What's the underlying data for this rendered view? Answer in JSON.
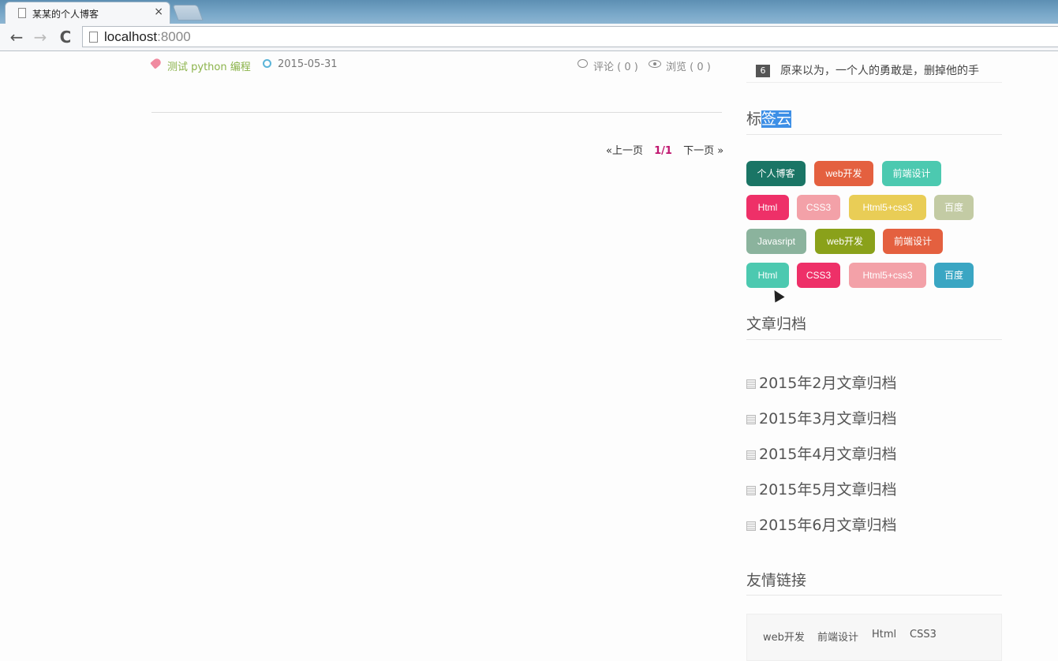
{
  "browser": {
    "tab_title": "某某的个人博客",
    "tab_close": "×",
    "url_host": "localhost",
    "url_port": ":8000",
    "back": "←",
    "forward": "→",
    "reload": "C"
  },
  "post_meta": {
    "tags": "测试 python 编程",
    "date": "2015-05-31",
    "comments": "评论 ( 0 )",
    "views": "浏览 ( 0 )"
  },
  "pager": {
    "prev": "«上一页",
    "current": "1/1",
    "next": "下一页 »"
  },
  "sidebar": {
    "top_item": {
      "rank": "6",
      "title": "原来以为，一个人的勇敢是，删掉他的手"
    },
    "tag_cloud": {
      "title_plain": "标",
      "title_selected": "签云",
      "tags": [
        {
          "label": "个人博客",
          "color": "#1a7565"
        },
        {
          "label": "web开发",
          "color": "#e4603f"
        },
        {
          "label": "前端设计",
          "color": "#4cc9b0"
        },
        {
          "label": "Html",
          "color": "#ee3068"
        },
        {
          "label": "CSS3",
          "color": "#f3a1a8"
        },
        {
          "label": "Html5+css3",
          "color": "#e9cd56"
        },
        {
          "label": "百度",
          "color": "#c3cba4"
        },
        {
          "label": "Javasript",
          "color": "#8bb39d"
        },
        {
          "label": "web开发",
          "color": "#8aa11a"
        },
        {
          "label": "前端设计",
          "color": "#e4603f"
        },
        {
          "label": "Html",
          "color": "#4cc9b0"
        },
        {
          "label": "CSS3",
          "color": "#ee3068"
        },
        {
          "label": "Html5+css3",
          "color": "#f3a1a8"
        },
        {
          "label": "百度",
          "color": "#3aa6c3"
        }
      ]
    },
    "archive": {
      "title": "文章归档",
      "items": [
        "2015年2月文章归档",
        "2015年3月文章归档",
        "2015年4月文章归档",
        "2015年5月文章归档",
        "2015年6月文章归档"
      ]
    },
    "links": {
      "title": "友情链接",
      "items": [
        "web开发",
        "前端设计",
        "Html",
        "CSS3"
      ]
    }
  }
}
